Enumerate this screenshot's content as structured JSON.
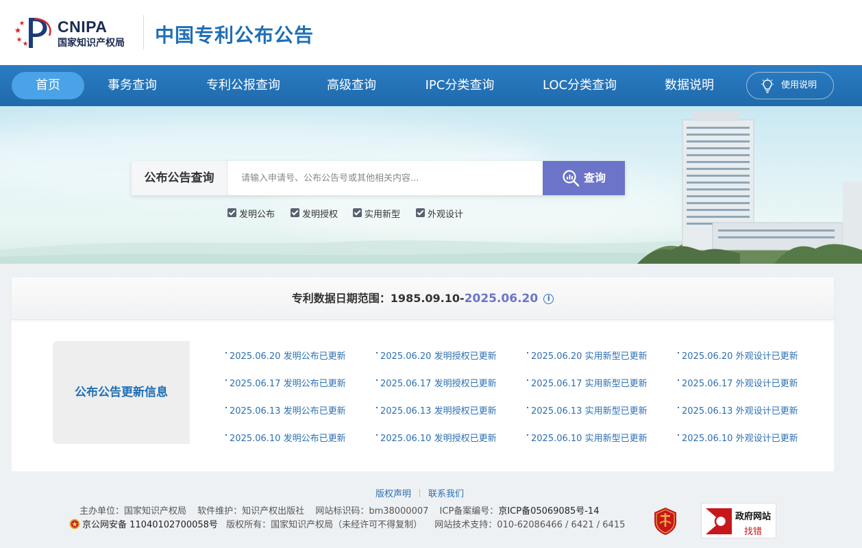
{
  "header": {
    "logo_en": "CNIPA",
    "logo_cn": "国家知识产权局",
    "site_title": "中国专利公布公告"
  },
  "nav": {
    "items": [
      {
        "label": "首页",
        "active": true
      },
      {
        "label": "事务查询"
      },
      {
        "label": "专利公报查询"
      },
      {
        "label": "高级查询"
      },
      {
        "label": "IPC分类查询"
      },
      {
        "label": "LOC分类查询"
      },
      {
        "label": "数据说明"
      }
    ],
    "help_label": "使用说明",
    "help_icon": "lightbulb-icon"
  },
  "search": {
    "label": "公布公告查询",
    "placeholder": "请输入申请号、公布公告号或其他相关内容...",
    "value": "",
    "button_label": "查询",
    "button_icon": "search-icon",
    "filters": [
      {
        "label": "发明公布",
        "checked": true
      },
      {
        "label": "发明授权",
        "checked": true
      },
      {
        "label": "实用新型",
        "checked": true
      },
      {
        "label": "外观设计",
        "checked": true
      }
    ]
  },
  "data_range": {
    "label": "专利数据日期范围：",
    "start": "1985.09.10-",
    "end": "2025.06.20",
    "info_icon": "info-icon"
  },
  "updates": {
    "title": "公布公告更新信息",
    "rows": [
      [
        "2025.06.20 发明公布已更新",
        "2025.06.20 发明授权已更新",
        "2025.06.20 实用新型已更新",
        "2025.06.20 外观设计已更新"
      ],
      [
        "2025.06.17 发明公布已更新",
        "2025.06.17 发明授权已更新",
        "2025.06.17 实用新型已更新",
        "2025.06.17 外观设计已更新"
      ],
      [
        "2025.06.13 发明公布已更新",
        "2025.06.13 发明授权已更新",
        "2025.06.13 实用新型已更新",
        "2025.06.13 外观设计已更新"
      ],
      [
        "2025.06.10 发明公布已更新",
        "2025.06.10 发明授权已更新",
        "2025.06.10 实用新型已更新",
        "2025.06.10 外观设计已更新"
      ]
    ]
  },
  "footer": {
    "links": [
      "版权声明",
      "联系我们"
    ],
    "line1": {
      "sponsor": "主办单位：国家知识产权局",
      "maintenance": "软件维护：知识产权出版社",
      "site_code": "网站标识码：bm38000007",
      "icp_label": "ICP备案编号：",
      "icp_value": "京ICP备05069085号-14"
    },
    "line2": {
      "police": "京公网安备 11040102700058号",
      "copyright": "版权所有：国家知识产权局（未经许可不得复制）",
      "support": "网站技术支持：010-62086466 / 6421 / 6415"
    },
    "gov_badge": {
      "line1": "政府网站",
      "line2": "找错"
    }
  },
  "colors": {
    "nav_bg": "#1f6aab",
    "nav_active": "#49a3e6",
    "title_blue": "#1f6fb5",
    "search_button": "#6c74c9",
    "link_blue": "#2c6fb2"
  }
}
